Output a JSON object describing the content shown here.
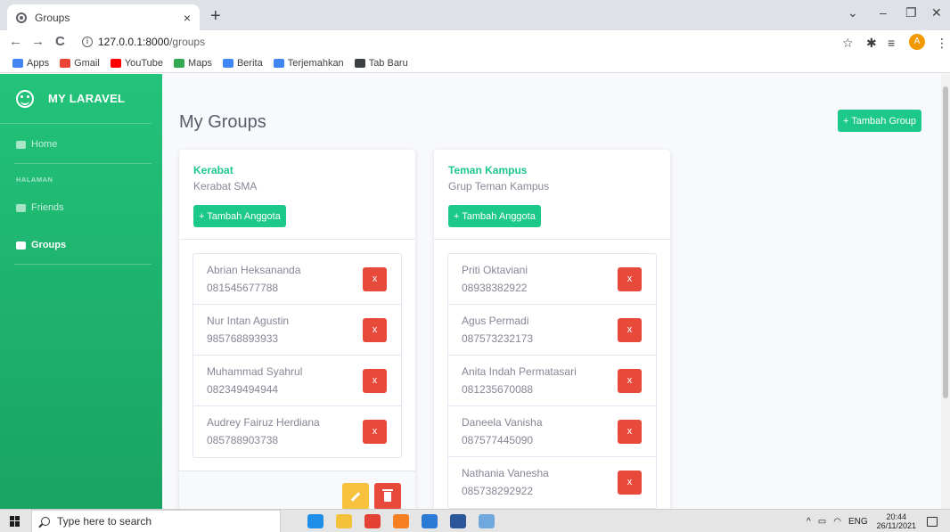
{
  "browser": {
    "tab_title": "Groups",
    "tab_close": "×",
    "new_tab": "+",
    "url_host": "127.0.0.1:8000",
    "url_path": "/groups",
    "bookmarks": [
      {
        "label": "Apps",
        "color": "#4285f4"
      },
      {
        "label": "Gmail",
        "color": "#ea4335"
      },
      {
        "label": "YouTube",
        "color": "#ff0000"
      },
      {
        "label": "Maps",
        "color": "#34a853"
      },
      {
        "label": "Berita",
        "color": "#4285f4"
      },
      {
        "label": "Terjemahkan",
        "color": "#4285f4"
      },
      {
        "label": "Tab Baru",
        "color": "#3c4043"
      }
    ],
    "profile_initial": "A"
  },
  "sidebar": {
    "brand": "MY LARAVEL",
    "home": "Home",
    "heading": "HALAMAN",
    "friends": "Friends",
    "groups": "Groups"
  },
  "main": {
    "title": "My Groups",
    "add_group_label": "+ Tambah Group",
    "add_member_label": "+ Tambah Anggota",
    "remove_label": "x",
    "groups": [
      {
        "name": "Kerabat",
        "description": "Kerabat SMA",
        "members": [
          {
            "name": "Abrian Heksananda",
            "phone": "081545677788"
          },
          {
            "name": "Nur Intan Agustin",
            "phone": "985768893933"
          },
          {
            "name": "Muhammad Syahrul",
            "phone": "082349494944"
          },
          {
            "name": "Audrey Fairuz Herdiana",
            "phone": "085788903738"
          }
        ]
      },
      {
        "name": "Teman Kampus",
        "description": "Grup Teman Kampus",
        "members": [
          {
            "name": "Priti Oktaviani",
            "phone": "08938382922"
          },
          {
            "name": "Agus Permadi",
            "phone": "087573232173"
          },
          {
            "name": "Anita Indah Permatasari",
            "phone": "081235670088"
          },
          {
            "name": "Daneela Vanisha",
            "phone": "087577445090"
          },
          {
            "name": "Nathania Vanesha",
            "phone": "085738292922"
          }
        ]
      }
    ]
  },
  "taskbar": {
    "search_placeholder": "Type here to search",
    "language": "ENG",
    "time": "20:44",
    "date": "26/11/2021"
  },
  "colors": {
    "primary_green": "#1cc88a",
    "danger_red": "#e74a3b",
    "warning_yellow": "#f6c23e"
  }
}
